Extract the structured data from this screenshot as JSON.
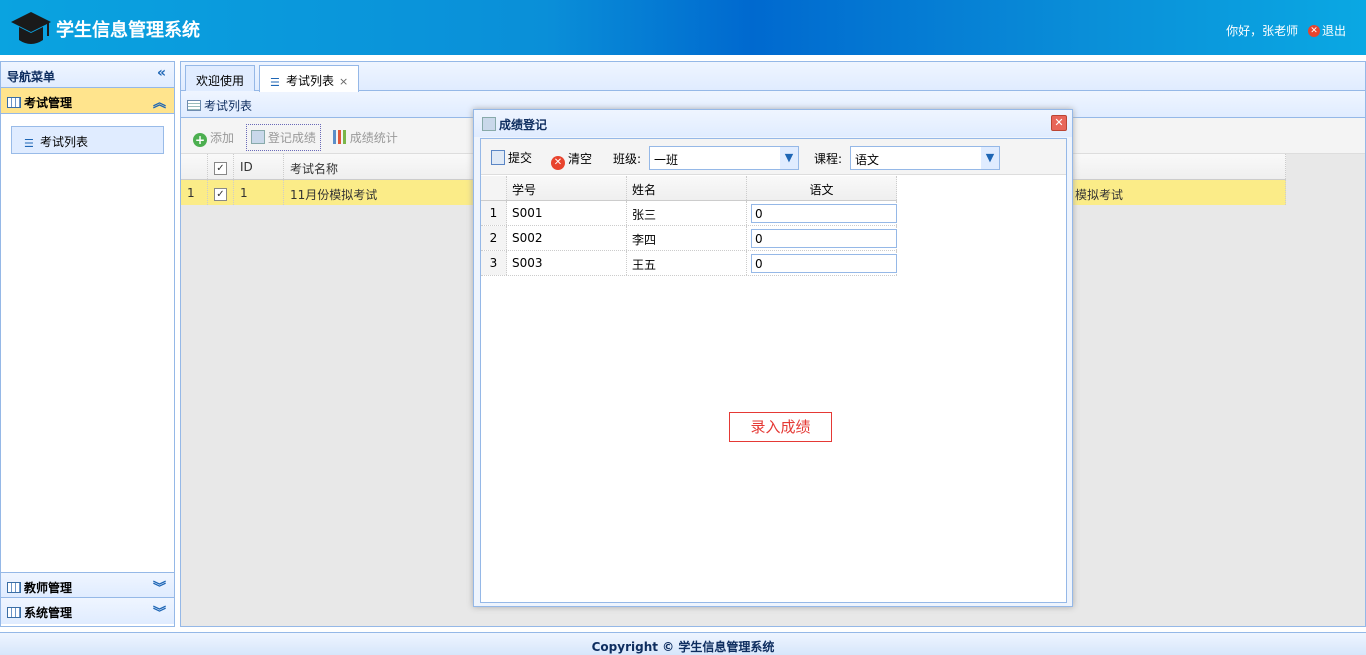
{
  "header": {
    "title": "学生信息管理系统",
    "greeting": "你好，张老师",
    "logout": "退出",
    "logo_icon": "graduation-cap-icon"
  },
  "sidebar": {
    "title": "导航菜单",
    "sections": [
      {
        "label": "考试管理",
        "expanded": true,
        "items": [
          {
            "label": "考试列表"
          }
        ]
      },
      {
        "label": "教师管理",
        "expanded": false
      },
      {
        "label": "系统管理",
        "expanded": false
      }
    ]
  },
  "tabs": [
    {
      "label": "欢迎使用",
      "active": false
    },
    {
      "label": "考试列表",
      "active": true,
      "close": "×"
    }
  ],
  "panel": {
    "title": "考试列表",
    "toolbar": {
      "add": "添加",
      "register": "登记成绩",
      "stats": "成绩统计"
    },
    "columns": [
      "ID",
      "考试名称"
    ],
    "rows": [
      {
        "num": "1",
        "id": "1",
        "name": "11月份模拟考试",
        "extra": "模拟考试"
      }
    ]
  },
  "dialog": {
    "title": "成绩登记",
    "submit": "提交",
    "clear": "清空",
    "class_label": "班级:",
    "class_value": "一班",
    "course_label": "课程:",
    "course_value": "语文",
    "columns": [
      "学号",
      "姓名",
      "语文"
    ],
    "rows": [
      {
        "num": "1",
        "sid": "S001",
        "name": "张三",
        "score": "0"
      },
      {
        "num": "2",
        "sid": "S002",
        "name": "李四",
        "score": "0"
      },
      {
        "num": "3",
        "sid": "S003",
        "name": "王五",
        "score": "0"
      }
    ],
    "enter_button": "录入成绩"
  },
  "footer": {
    "text": "Copyright © 学生信息管理系统"
  }
}
